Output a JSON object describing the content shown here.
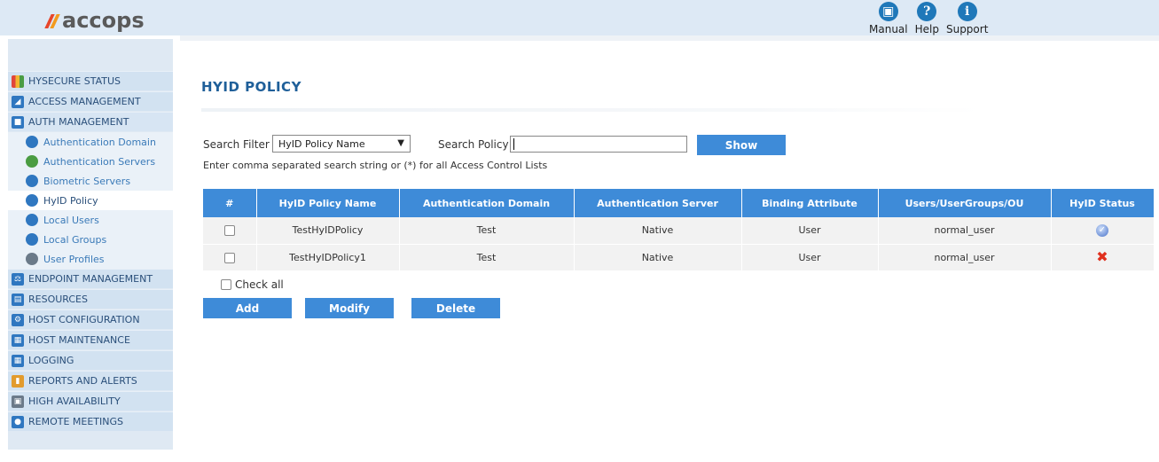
{
  "header": {
    "logo_text": "accops",
    "links": [
      {
        "label": "Manual",
        "icon": "manual-icon"
      },
      {
        "label": "Help",
        "icon": "help-icon"
      },
      {
        "label": "Support",
        "icon": "support-icon"
      }
    ]
  },
  "sidebar": {
    "items": [
      {
        "label": "HYSECURE STATUS",
        "icon": "status-icon"
      },
      {
        "label": "ACCESS MANAGEMENT",
        "icon": "access-icon"
      },
      {
        "label": "AUTH MANAGEMENT",
        "icon": "lock-icon"
      },
      {
        "label": "ENDPOINT MANAGEMENT",
        "icon": "scale-icon"
      },
      {
        "label": "RESOURCES",
        "icon": "resources-icon"
      },
      {
        "label": "HOST CONFIGURATION",
        "icon": "gear-icon"
      },
      {
        "label": "HOST MAINTENANCE",
        "icon": "cart-icon"
      },
      {
        "label": "LOGGING",
        "icon": "calendar-icon"
      },
      {
        "label": "REPORTS AND ALERTS",
        "icon": "chart-icon"
      },
      {
        "label": "HIGH AVAILABILITY",
        "icon": "grid-icon"
      },
      {
        "label": "REMOTE MEETINGS",
        "icon": "meeting-icon"
      }
    ],
    "auth_sub_items": [
      {
        "label": "Authentication Domain",
        "icon": "globe-icon"
      },
      {
        "label": "Authentication Servers",
        "icon": "server-icon"
      },
      {
        "label": "Biometric Servers",
        "icon": "biometric-icon"
      },
      {
        "label": "HyID Policy",
        "icon": "policy-icon"
      },
      {
        "label": "Local Users",
        "icon": "user-icon"
      },
      {
        "label": "Local Groups",
        "icon": "group-icon"
      },
      {
        "label": "User Profiles",
        "icon": "profile-icon"
      }
    ]
  },
  "main": {
    "title": "HYID POLICY",
    "search": {
      "filter_label": "Search Filter",
      "filter_value": "HyID Policy Name",
      "policy_label": "Search Policy",
      "policy_value": "",
      "show_label": "Show",
      "hint": "Enter comma separated search string or (*) for all Access Control Lists"
    },
    "table": {
      "headers": [
        "#",
        "HyID Policy Name",
        "Authentication Domain",
        "Authentication Server",
        "Binding Attribute",
        "Users/UserGroups/OU",
        "HyID Status"
      ],
      "rows": [
        {
          "name": "TestHyIDPolicy",
          "domain": "Test",
          "server": "Native",
          "binding": "User",
          "users": "normal_user",
          "status": "enabled"
        },
        {
          "name": "TestHyIDPolicy1",
          "domain": "Test",
          "server": "Native",
          "binding": "User",
          "users": "normal_user",
          "status": "disabled"
        }
      ]
    },
    "check_all_label": "Check all",
    "buttons": {
      "add": "Add",
      "modify": "Modify",
      "delete": "Delete"
    }
  }
}
